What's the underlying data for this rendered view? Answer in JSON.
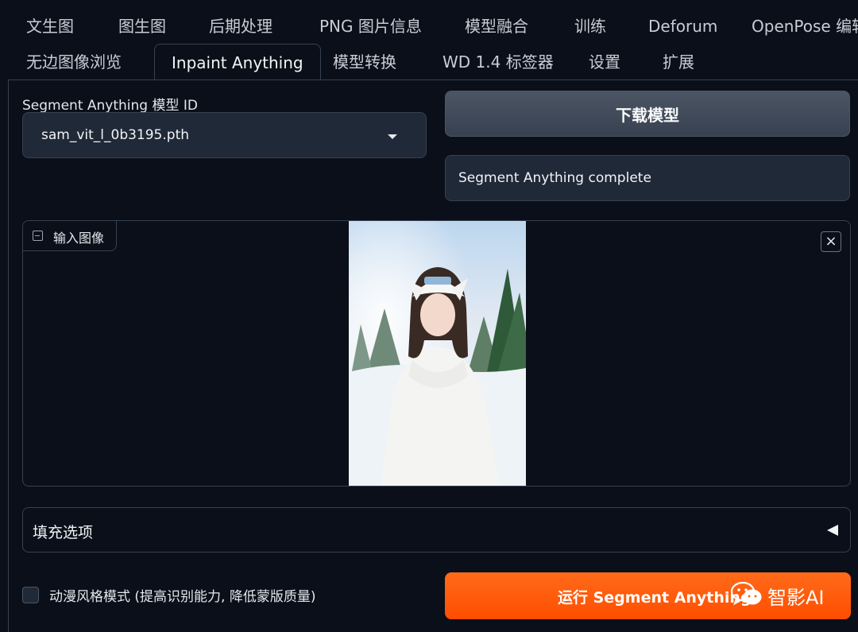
{
  "tabs_row1": [
    "文生图",
    "图生图",
    "后期处理",
    "PNG 图片信息",
    "模型融合",
    "训练",
    "Deforum",
    "OpenPose 编辑"
  ],
  "tabs_row2": [
    "无边图像浏览",
    "Inpaint Anything",
    "模型转换",
    "WD 1.4 标签器",
    "设置",
    "扩展"
  ],
  "active_tab": "Inpaint Anything",
  "model_section": {
    "label": "Segment Anything 模型 ID",
    "selected": "sam_vit_l_0b3195.pth",
    "download_button": "下载模型",
    "status": "Segment Anything complete"
  },
  "image_input": {
    "label": "输入图像",
    "close": "×"
  },
  "fill_options": {
    "label": "填充选项"
  },
  "anime_mode": {
    "label": "动漫风格模式 (提高识别能力, 降低蒙版质量)",
    "checked": false
  },
  "run_button": "运行 Segment Anything",
  "watermark": "智影AI",
  "colors": {
    "accent": "#ff5a0a",
    "background": "#0b0f19",
    "panel": "#1f2937",
    "border": "#374151"
  }
}
